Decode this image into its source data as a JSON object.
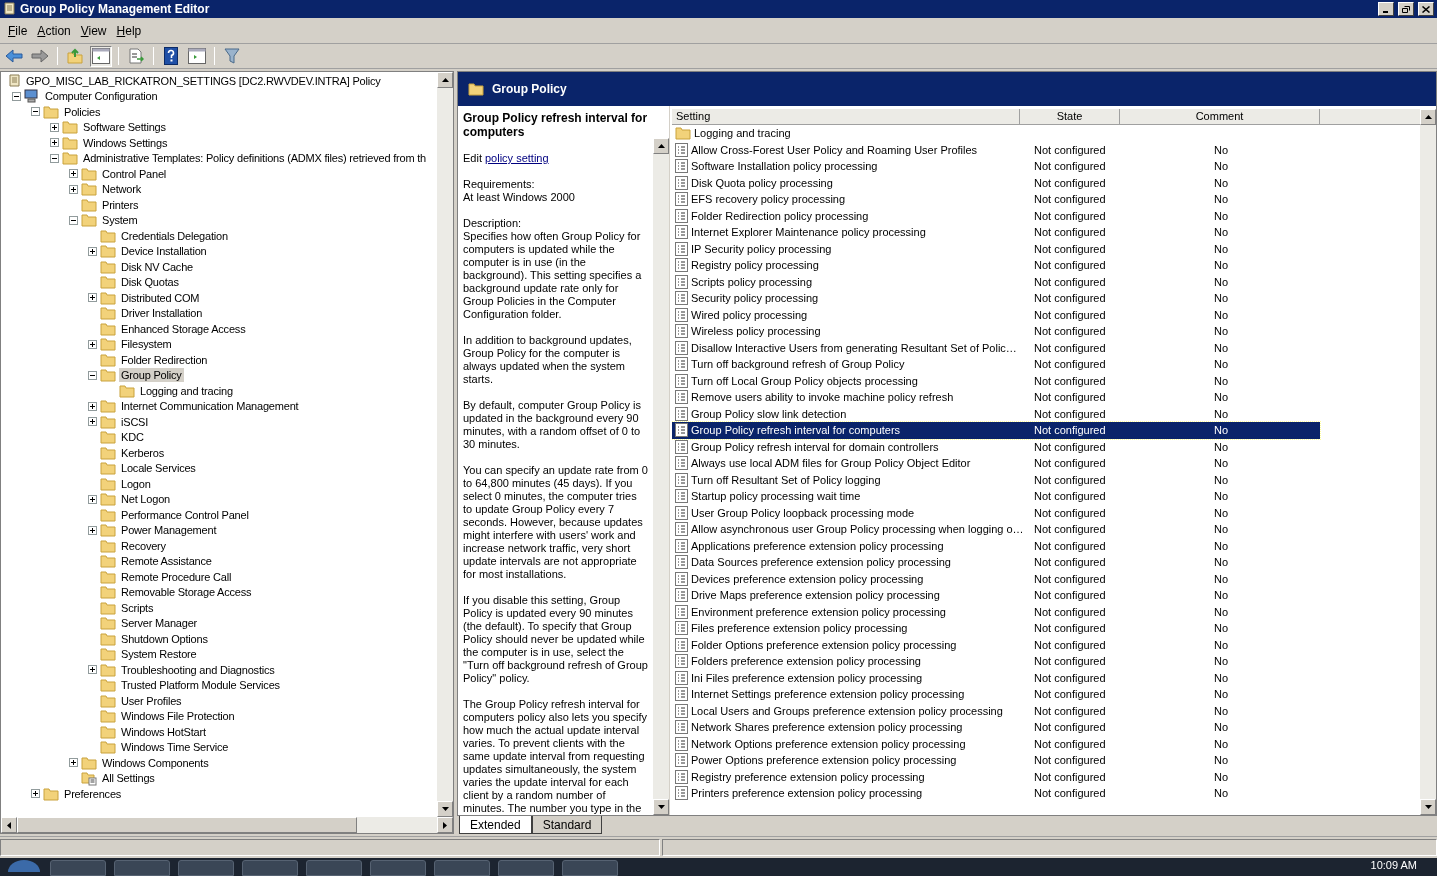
{
  "window": {
    "title": "Group Policy Management Editor"
  },
  "menu": [
    {
      "label": "File"
    },
    {
      "label": "Action"
    },
    {
      "label": "View"
    },
    {
      "label": "Help"
    }
  ],
  "toolbar": [
    {
      "kind": "back",
      "pressed": false
    },
    {
      "kind": "forward",
      "pressed": false
    },
    {
      "kind": "sep"
    },
    {
      "kind": "up",
      "pressed": false
    },
    {
      "kind": "tree",
      "pressed": true
    },
    {
      "kind": "sep"
    },
    {
      "kind": "export",
      "pressed": false
    },
    {
      "kind": "sep"
    },
    {
      "kind": "help",
      "pressed": false
    },
    {
      "kind": "pane",
      "pressed": false
    },
    {
      "kind": "sep"
    },
    {
      "kind": "filter",
      "pressed": false
    }
  ],
  "tree": [
    {
      "label": "GPO_MISC_LAB_RICKATRON_SETTINGS [DC2.RWVDEV.INTRA] Policy",
      "kind": "policy",
      "expandable": false,
      "expanded": true,
      "selected": false,
      "children": [
        {
          "label": "Computer Configuration",
          "kind": "computer",
          "expandable": true,
          "expanded": true,
          "selected": false,
          "children": [
            {
              "label": "Policies",
              "kind": "folder",
              "expandable": true,
              "expanded": true,
              "selected": false,
              "children": [
                {
                  "label": "Software Settings",
                  "kind": "folder",
                  "expandable": true,
                  "expanded": false,
                  "selected": false
                },
                {
                  "label": "Windows Settings",
                  "kind": "folder",
                  "expandable": true,
                  "expanded": false,
                  "selected": false
                },
                {
                  "label": "Administrative Templates: Policy definitions (ADMX files) retrieved from th",
                  "kind": "folder",
                  "expandable": true,
                  "expanded": true,
                  "selected": false,
                  "children": [
                    {
                      "label": "Control Panel",
                      "kind": "folder",
                      "expandable": true,
                      "expanded": false,
                      "selected": false
                    },
                    {
                      "label": "Network",
                      "kind": "folder",
                      "expandable": true,
                      "expanded": false,
                      "selected": false
                    },
                    {
                      "label": "Printers",
                      "kind": "folder",
                      "expandable": false,
                      "expanded": false,
                      "selected": false
                    },
                    {
                      "label": "System",
                      "kind": "folder",
                      "expandable": true,
                      "expanded": true,
                      "selected": false,
                      "children": [
                        {
                          "label": "Credentials Delegation",
                          "kind": "folder",
                          "expandable": false,
                          "expanded": false,
                          "selected": false
                        },
                        {
                          "label": "Device Installation",
                          "kind": "folder",
                          "expandable": true,
                          "expanded": false,
                          "selected": false
                        },
                        {
                          "label": "Disk NV Cache",
                          "kind": "folder",
                          "expandable": false,
                          "expanded": false,
                          "selected": false
                        },
                        {
                          "label": "Disk Quotas",
                          "kind": "folder",
                          "expandable": false,
                          "expanded": false,
                          "selected": false
                        },
                        {
                          "label": "Distributed COM",
                          "kind": "folder",
                          "expandable": true,
                          "expanded": false,
                          "selected": false
                        },
                        {
                          "label": "Driver Installation",
                          "kind": "folder",
                          "expandable": false,
                          "expanded": false,
                          "selected": false
                        },
                        {
                          "label": "Enhanced Storage Access",
                          "kind": "folder",
                          "expandable": false,
                          "expanded": false,
                          "selected": false
                        },
                        {
                          "label": "Filesystem",
                          "kind": "folder",
                          "expandable": true,
                          "expanded": false,
                          "selected": false
                        },
                        {
                          "label": "Folder Redirection",
                          "kind": "folder",
                          "expandable": false,
                          "expanded": false,
                          "selected": false
                        },
                        {
                          "label": "Group Policy",
                          "kind": "folder",
                          "expandable": true,
                          "expanded": true,
                          "selected": true,
                          "children": [
                            {
                              "label": "Logging and tracing",
                              "kind": "folder",
                              "expandable": false,
                              "expanded": false,
                              "selected": false
                            }
                          ]
                        },
                        {
                          "label": "Internet Communication Management",
                          "kind": "folder",
                          "expandable": true,
                          "expanded": false,
                          "selected": false
                        },
                        {
                          "label": "iSCSI",
                          "kind": "folder",
                          "expandable": true,
                          "expanded": false,
                          "selected": false
                        },
                        {
                          "label": "KDC",
                          "kind": "folder",
                          "expandable": false,
                          "expanded": false,
                          "selected": false
                        },
                        {
                          "label": "Kerberos",
                          "kind": "folder",
                          "expandable": false,
                          "expanded": false,
                          "selected": false
                        },
                        {
                          "label": "Locale Services",
                          "kind": "folder",
                          "expandable": false,
                          "expanded": false,
                          "selected": false
                        },
                        {
                          "label": "Logon",
                          "kind": "folder",
                          "expandable": false,
                          "expanded": false,
                          "selected": false
                        },
                        {
                          "label": "Net Logon",
                          "kind": "folder",
                          "expandable": true,
                          "expanded": false,
                          "selected": false
                        },
                        {
                          "label": "Performance Control Panel",
                          "kind": "folder",
                          "expandable": false,
                          "expanded": false,
                          "selected": false
                        },
                        {
                          "label": "Power Management",
                          "kind": "folder",
                          "expandable": true,
                          "expanded": false,
                          "selected": false
                        },
                        {
                          "label": "Recovery",
                          "kind": "folder",
                          "expandable": false,
                          "expanded": false,
                          "selected": false
                        },
                        {
                          "label": "Remote Assistance",
                          "kind": "folder",
                          "expandable": false,
                          "expanded": false,
                          "selected": false
                        },
                        {
                          "label": "Remote Procedure Call",
                          "kind": "folder",
                          "expandable": false,
                          "expanded": false,
                          "selected": false
                        },
                        {
                          "label": "Removable Storage Access",
                          "kind": "folder",
                          "expandable": false,
                          "expanded": false,
                          "selected": false
                        },
                        {
                          "label": "Scripts",
                          "kind": "folder",
                          "expandable": false,
                          "expanded": false,
                          "selected": false
                        },
                        {
                          "label": "Server Manager",
                          "kind": "folder",
                          "expandable": false,
                          "expanded": false,
                          "selected": false
                        },
                        {
                          "label": "Shutdown Options",
                          "kind": "folder",
                          "expandable": false,
                          "expanded": false,
                          "selected": false
                        },
                        {
                          "label": "System Restore",
                          "kind": "folder",
                          "expandable": false,
                          "expanded": false,
                          "selected": false
                        },
                        {
                          "label": "Troubleshooting and Diagnostics",
                          "kind": "folder",
                          "expandable": true,
                          "expanded": false,
                          "selected": false
                        },
                        {
                          "label": "Trusted Platform Module Services",
                          "kind": "folder",
                          "expandable": false,
                          "expanded": false,
                          "selected": false
                        },
                        {
                          "label": "User Profiles",
                          "kind": "folder",
                          "expandable": false,
                          "expanded": false,
                          "selected": false
                        },
                        {
                          "label": "Windows File Protection",
                          "kind": "folder",
                          "expandable": false,
                          "expanded": false,
                          "selected": false
                        },
                        {
                          "label": "Windows HotStart",
                          "kind": "folder",
                          "expandable": false,
                          "expanded": false,
                          "selected": false
                        },
                        {
                          "label": "Windows Time Service",
                          "kind": "folder",
                          "expandable": false,
                          "expanded": false,
                          "selected": false
                        }
                      ]
                    },
                    {
                      "label": "Windows Components",
                      "kind": "folder",
                      "expandable": true,
                      "expanded": false,
                      "selected": false
                    },
                    {
                      "label": "All Settings",
                      "kind": "settings",
                      "expandable": false,
                      "expanded": false,
                      "selected": false
                    }
                  ]
                }
              ]
            },
            {
              "label": "Preferences",
              "kind": "folder",
              "expandable": true,
              "expanded": false,
              "selected": false
            }
          ]
        }
      ]
    }
  ],
  "header": {
    "title": "Group Policy"
  },
  "description": {
    "title": "Group Policy refresh interval for computers",
    "edit_label": "Edit",
    "edit_link": "policy setting",
    "requirements_label": "Requirements:",
    "requirements": "At least Windows 2000",
    "description_label": "Description:",
    "paragraphs": [
      "Specifies how often Group Policy for computers is updated while the computer is in use (in the background). This setting specifies a background update rate only for Group Policies in the Computer Configuration folder.",
      "In addition to background updates, Group Policy for the computer is always updated when the system starts.",
      "By default, computer Group Policy is updated in the background every 90 minutes, with a random offset of 0 to 30 minutes.",
      "You can specify an update rate from 0 to 64,800 minutes (45 days). If you select 0 minutes, the computer tries to update Group Policy every 7 seconds. However, because updates might interfere with users' work and increase network traffic, very short update intervals are not appropriate for most installations.",
      "If you disable this setting, Group Policy is updated every 90 minutes (the default). To specify that Group Policy should never be updated while the computer is in use, select the \"Turn off background refresh of Group Policy\" policy.",
      "The Group Policy refresh interval for computers policy also lets you specify how much the actual update interval varies. To prevent clients with the same update interval from requesting updates simultaneously, the system varies the update interval for each client by a random number of minutes. The number you type in the"
    ]
  },
  "table": {
    "columns": [
      "Setting",
      "State",
      "Comment"
    ],
    "rows": [
      {
        "kind": "folder",
        "setting": "Logging and tracing",
        "selected": false
      },
      {
        "kind": "policy",
        "setting": "Allow Cross-Forest User Policy and Roaming User Profiles",
        "state": "Not configured",
        "comment": "No",
        "selected": false
      },
      {
        "kind": "policy",
        "setting": "Software Installation policy processing",
        "state": "Not configured",
        "comment": "No",
        "selected": false
      },
      {
        "kind": "policy",
        "setting": "Disk Quota policy processing",
        "state": "Not configured",
        "comment": "No",
        "selected": false
      },
      {
        "kind": "policy",
        "setting": "EFS recovery policy processing",
        "state": "Not configured",
        "comment": "No",
        "selected": false
      },
      {
        "kind": "policy",
        "setting": "Folder Redirection policy processing",
        "state": "Not configured",
        "comment": "No",
        "selected": false
      },
      {
        "kind": "policy",
        "setting": "Internet Explorer Maintenance policy processing",
        "state": "Not configured",
        "comment": "No",
        "selected": false
      },
      {
        "kind": "policy",
        "setting": "IP Security policy processing",
        "state": "Not configured",
        "comment": "No",
        "selected": false
      },
      {
        "kind": "policy",
        "setting": "Registry policy processing",
        "state": "Not configured",
        "comment": "No",
        "selected": false
      },
      {
        "kind": "policy",
        "setting": "Scripts policy processing",
        "state": "Not configured",
        "comment": "No",
        "selected": false
      },
      {
        "kind": "policy",
        "setting": "Security policy processing",
        "state": "Not configured",
        "comment": "No",
        "selected": false
      },
      {
        "kind": "policy",
        "setting": "Wired policy processing",
        "state": "Not configured",
        "comment": "No",
        "selected": false
      },
      {
        "kind": "policy",
        "setting": "Wireless policy processing",
        "state": "Not configured",
        "comment": "No",
        "selected": false
      },
      {
        "kind": "policy",
        "setting": "Disallow Interactive Users from generating Resultant Set of Polic…",
        "state": "Not configured",
        "comment": "No",
        "selected": false
      },
      {
        "kind": "policy",
        "setting": "Turn off background refresh of Group Policy",
        "state": "Not configured",
        "comment": "No",
        "selected": false
      },
      {
        "kind": "policy",
        "setting": "Turn off Local Group Policy objects processing",
        "state": "Not configured",
        "comment": "No",
        "selected": false
      },
      {
        "kind": "policy",
        "setting": "Remove users ability to invoke machine policy refresh",
        "state": "Not configured",
        "comment": "No",
        "selected": false
      },
      {
        "kind": "policy",
        "setting": "Group Policy slow link detection",
        "state": "Not configured",
        "comment": "No",
        "selected": false
      },
      {
        "kind": "policy",
        "setting": "Group Policy refresh interval for computers",
        "state": "Not configured",
        "comment": "No",
        "selected": true
      },
      {
        "kind": "policy",
        "setting": "Group Policy refresh interval for domain controllers",
        "state": "Not configured",
        "comment": "No",
        "selected": false
      },
      {
        "kind": "policy",
        "setting": "Always use local ADM files for Group Policy Object Editor",
        "state": "Not configured",
        "comment": "No",
        "selected": false
      },
      {
        "kind": "policy",
        "setting": "Turn off Resultant Set of Policy logging",
        "state": "Not configured",
        "comment": "No",
        "selected": false
      },
      {
        "kind": "policy",
        "setting": "Startup policy processing wait time",
        "state": "Not configured",
        "comment": "No",
        "selected": false
      },
      {
        "kind": "policy",
        "setting": "User Group Policy loopback processing mode",
        "state": "Not configured",
        "comment": "No",
        "selected": false
      },
      {
        "kind": "policy",
        "setting": "Allow asynchronous user Group Policy processing when logging o…",
        "state": "Not configured",
        "comment": "No",
        "selected": false
      },
      {
        "kind": "policy",
        "setting": "Applications preference extension policy processing",
        "state": "Not configured",
        "comment": "No",
        "selected": false
      },
      {
        "kind": "policy",
        "setting": "Data Sources preference extension policy processing",
        "state": "Not configured",
        "comment": "No",
        "selected": false
      },
      {
        "kind": "policy",
        "setting": "Devices preference extension policy processing",
        "state": "Not configured",
        "comment": "No",
        "selected": false
      },
      {
        "kind": "policy",
        "setting": "Drive Maps preference extension policy processing",
        "state": "Not configured",
        "comment": "No",
        "selected": false
      },
      {
        "kind": "policy",
        "setting": "Environment preference extension policy processing",
        "state": "Not configured",
        "comment": "No",
        "selected": false
      },
      {
        "kind": "policy",
        "setting": "Files preference extension policy processing",
        "state": "Not configured",
        "comment": "No",
        "selected": false
      },
      {
        "kind": "policy",
        "setting": "Folder Options preference extension policy processing",
        "state": "Not configured",
        "comment": "No",
        "selected": false
      },
      {
        "kind": "policy",
        "setting": "Folders preference extension policy processing",
        "state": "Not configured",
        "comment": "No",
        "selected": false
      },
      {
        "kind": "policy",
        "setting": "Ini Files preference extension policy processing",
        "state": "Not configured",
        "comment": "No",
        "selected": false
      },
      {
        "kind": "policy",
        "setting": "Internet Settings preference extension policy processing",
        "state": "Not configured",
        "comment": "No",
        "selected": false
      },
      {
        "kind": "policy",
        "setting": "Local Users and Groups preference extension policy processing",
        "state": "Not configured",
        "comment": "No",
        "selected": false
      },
      {
        "kind": "policy",
        "setting": "Network Shares preference extension policy processing",
        "state": "Not configured",
        "comment": "No",
        "selected": false
      },
      {
        "kind": "policy",
        "setting": "Network Options preference extension policy processing",
        "state": "Not configured",
        "comment": "No",
        "selected": false
      },
      {
        "kind": "policy",
        "setting": "Power Options preference extension policy processing",
        "state": "Not configured",
        "comment": "No",
        "selected": false
      },
      {
        "kind": "policy",
        "setting": "Registry preference extension policy processing",
        "state": "Not configured",
        "comment": "No",
        "selected": false
      },
      {
        "kind": "policy",
        "setting": "Printers preference extension policy processing",
        "state": "Not configured",
        "comment": "No",
        "selected": false
      }
    ]
  },
  "tabs": [
    {
      "label": "Extended",
      "selected": true
    },
    {
      "label": "Standard",
      "selected": false
    }
  ],
  "taskbar": {
    "time": "10:09 AM"
  }
}
